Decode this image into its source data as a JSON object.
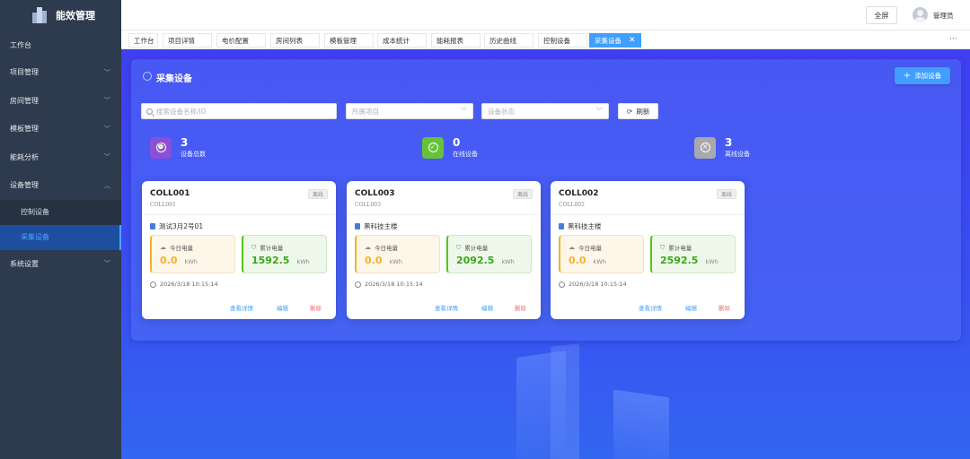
{
  "app": {
    "title": "能效管理"
  },
  "sidebar": {
    "items": [
      {
        "label": "工作台",
        "expandable": false
      },
      {
        "label": "项目管理",
        "expandable": true
      },
      {
        "label": "房间管理",
        "expandable": true
      },
      {
        "label": "模板管理",
        "expandable": true
      },
      {
        "label": "能耗分析",
        "expandable": true
      },
      {
        "label": "设备管理",
        "expandable": true,
        "expanded": true
      },
      {
        "label": "系统设置",
        "expandable": true
      }
    ],
    "subitems": [
      {
        "label": "控制设备"
      },
      {
        "label": "采集设备",
        "active": true
      }
    ]
  },
  "header": {
    "fullscreen_label": "全屏",
    "username": "管理员"
  },
  "tabs": [
    {
      "label": "工作台"
    },
    {
      "label": "项目详情"
    },
    {
      "label": "电价配置"
    },
    {
      "label": "房间列表"
    },
    {
      "label": "模板管理"
    },
    {
      "label": "成本统计"
    },
    {
      "label": "能耗报表"
    },
    {
      "label": "历史曲线"
    },
    {
      "label": "控制设备"
    },
    {
      "label": "采集设备",
      "active": true
    }
  ],
  "tab_more": "···",
  "page": {
    "title": "采集设备",
    "add_button": "添加设备",
    "search_placeholder": "搜索设备名称/ID",
    "project_placeholder": "所属项目",
    "status_placeholder": "设备状态",
    "refresh_label": "刷新"
  },
  "stats": [
    {
      "value": "3",
      "label": "设备总数",
      "color": "#8c4fd8"
    },
    {
      "value": "0",
      "label": "在线设备",
      "color": "#67c23a"
    },
    {
      "value": "3",
      "label": "离线设备",
      "color": "#a9a9ad"
    }
  ],
  "devices": [
    {
      "name": "COLL001",
      "code": "COLL001",
      "status": "离线",
      "location": "测试3月2号01",
      "today_label": "今日电量",
      "today_value": "0.0",
      "total_label": "累计电量",
      "total_value": "1592.5",
      "unit": "kWh",
      "time": "2026/3/18 10:15:14",
      "actions": {
        "view": "查看详情",
        "edit": "编辑",
        "delete": "删除"
      }
    },
    {
      "name": "COLL003",
      "code": "COLL003",
      "status": "离线",
      "location": "黑科技主楼",
      "today_label": "今日电量",
      "today_value": "0.0",
      "total_label": "累计电量",
      "total_value": "2092.5",
      "unit": "kWh",
      "time": "2026/3/18 10:15:14",
      "actions": {
        "view": "查看详情",
        "edit": "编辑",
        "delete": "删除"
      }
    },
    {
      "name": "COLL002",
      "code": "COLL002",
      "status": "离线",
      "location": "黑科技主楼",
      "today_label": "今日电量",
      "today_value": "0.0",
      "total_label": "累计电量",
      "total_value": "2592.5",
      "unit": "kWh",
      "time": "2026/3/18 10:15:14",
      "actions": {
        "view": "查看详情",
        "edit": "编辑",
        "delete": "删除"
      }
    }
  ]
}
